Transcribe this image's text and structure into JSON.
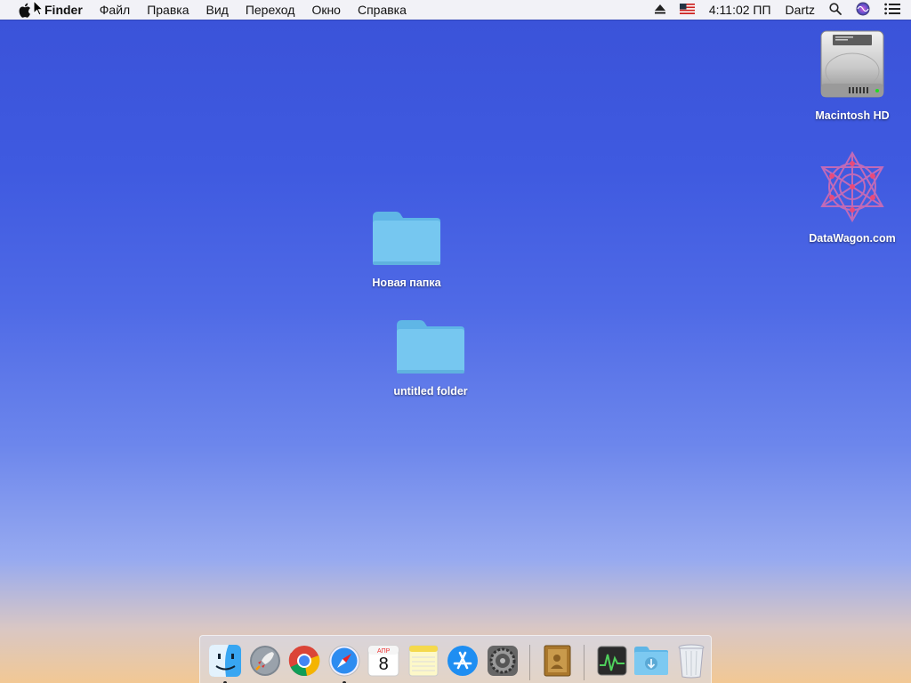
{
  "menubar": {
    "app_name": "Finder",
    "menus": [
      "Файл",
      "Правка",
      "Вид",
      "Переход",
      "Окно",
      "Справка"
    ],
    "time": "4:11:02 ПП",
    "user": "Dartz",
    "icons": [
      "apple-logo",
      "eject-icon",
      "us-flag-input-icon",
      "search-icon",
      "siri-icon",
      "notification-center-icon"
    ]
  },
  "desktop": {
    "items": [
      {
        "label": "Macintosh HD",
        "icon": "hard-drive-icon"
      },
      {
        "label": "DataWagon.com",
        "icon": "network-volume-icon"
      },
      {
        "label": "Новая папка",
        "icon": "folder-icon"
      },
      {
        "label": "untitled folder",
        "icon": "folder-icon"
      }
    ]
  },
  "dock": {
    "apps": [
      {
        "name": "finder-icon",
        "running": true
      },
      {
        "name": "launchpad-icon",
        "running": false
      },
      {
        "name": "chrome-icon",
        "running": false
      },
      {
        "name": "safari-icon",
        "running": true
      },
      {
        "name": "calendar-icon",
        "running": false
      },
      {
        "name": "notes-icon",
        "running": false
      },
      {
        "name": "app-store-icon",
        "running": false
      },
      {
        "name": "system-preferences-icon",
        "running": false
      },
      {
        "name": "contacts-icon",
        "running": false
      },
      {
        "name": "activity-monitor-icon",
        "running": false
      },
      {
        "name": "downloads-folder-icon",
        "running": false
      },
      {
        "name": "trash-icon",
        "running": false
      }
    ],
    "calendar": {
      "month": "АПР",
      "day": "8"
    }
  },
  "colors": {
    "folder": "#6fc3ee",
    "folder_dark": "#4aa9dc",
    "menubar_bg": "#f8f8f8"
  }
}
